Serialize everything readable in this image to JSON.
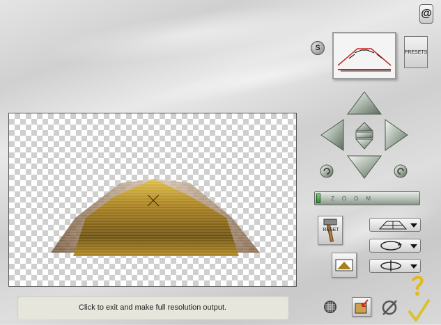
{
  "status": {
    "text": "Click to exit and make full resolution output."
  },
  "presets": {
    "label": "PRESETS"
  },
  "badge": {
    "s_label": "S"
  },
  "zoom": {
    "label": "ZOOM"
  },
  "reset": {
    "label": "RESET"
  },
  "dropdowns": [
    {
      "icon": "perspective-grid-icon"
    },
    {
      "icon": "rotate-ellipse-icon"
    },
    {
      "icon": "spin-axis-icon"
    }
  ],
  "icons": {
    "top_right": "app-logo-icon",
    "nav_up": "arrow-up-icon",
    "nav_down": "arrow-down-icon",
    "nav_left": "arrow-left-icon",
    "nav_right": "arrow-right-icon",
    "nav_center": "center-toggle-icon",
    "rotate_ccw": "rotate-ccw-icon",
    "rotate_cw": "rotate-cw-icon",
    "grid": "grid-icon",
    "save": "save-icon",
    "cancel": "cancel-icon",
    "ok": "ok-check-icon",
    "help": "help-icon"
  },
  "colors": {
    "accent_red": "#cc2222",
    "stair_gold": "#b08a24",
    "slider_green": "#2e8b2e"
  }
}
